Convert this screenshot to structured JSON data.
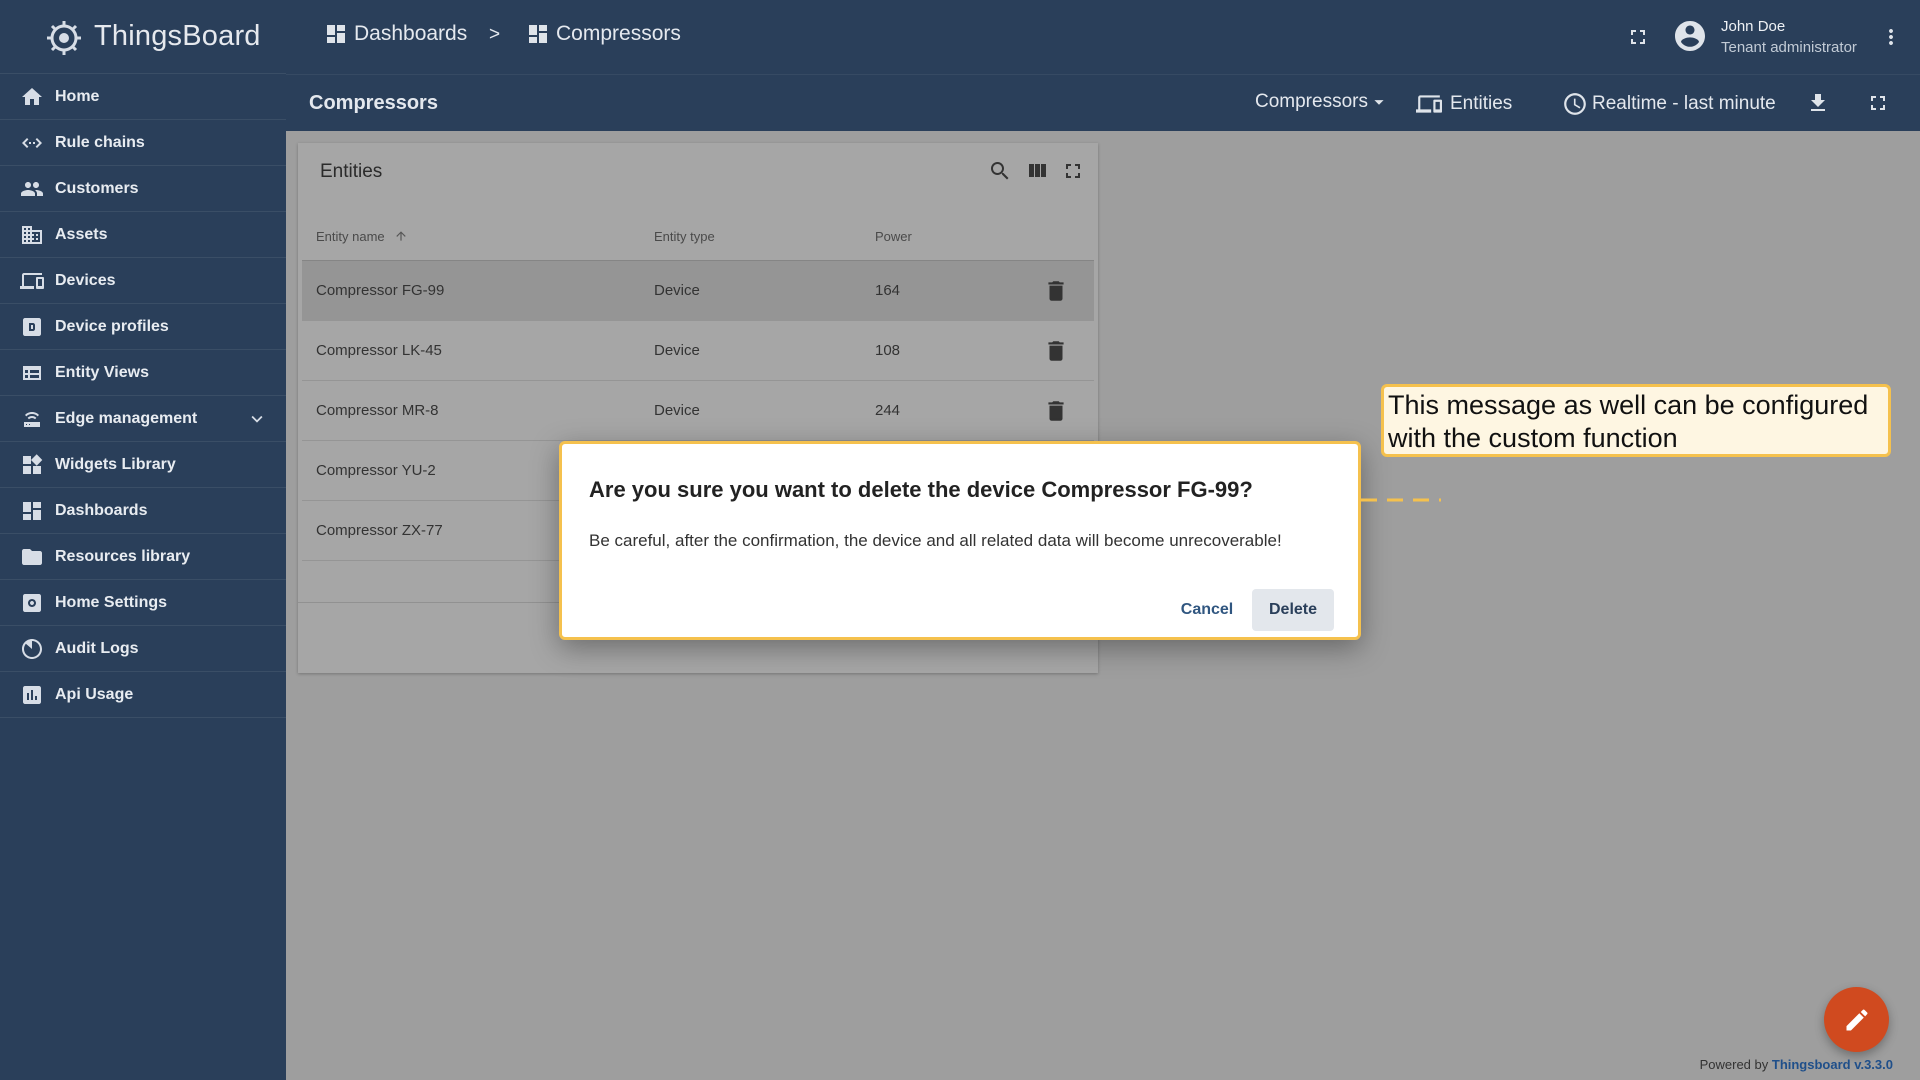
{
  "app": {
    "name": "ThingsBoard"
  },
  "sidebar": {
    "items": [
      {
        "label": "Home",
        "icon": "home-icon"
      },
      {
        "label": "Rule chains",
        "icon": "rule-chains-icon"
      },
      {
        "label": "Customers",
        "icon": "customers-icon"
      },
      {
        "label": "Assets",
        "icon": "assets-icon"
      },
      {
        "label": "Devices",
        "icon": "devices-icon"
      },
      {
        "label": "Device profiles",
        "icon": "device-profiles-icon"
      },
      {
        "label": "Entity Views",
        "icon": "entity-views-icon"
      },
      {
        "label": "Edge management",
        "icon": "edge-icon"
      },
      {
        "label": "Widgets Library",
        "icon": "widgets-icon"
      },
      {
        "label": "Dashboards",
        "icon": "dashboards-icon"
      },
      {
        "label": "Resources library",
        "icon": "folder-icon"
      },
      {
        "label": "Home Settings",
        "icon": "settings-icon"
      },
      {
        "label": "Audit Logs",
        "icon": "audit-icon"
      },
      {
        "label": "Api Usage",
        "icon": "api-usage-icon"
      }
    ]
  },
  "header": {
    "breadcrumb": [
      "Dashboards",
      "Compressors"
    ],
    "separator": ">",
    "user": {
      "name": "John Doe",
      "role": "Tenant administrator"
    }
  },
  "dashboard": {
    "title": "Compressors",
    "state_select": "Compressors",
    "entities_label": "Entities",
    "timewindow": "Realtime - last minute"
  },
  "widget": {
    "title": "Entities",
    "columns": [
      "Entity name",
      "Entity type",
      "Power"
    ],
    "rows": [
      {
        "name": "Compressor FG-99",
        "type": "Device",
        "power": "164"
      },
      {
        "name": "Compressor LK-45",
        "type": "Device",
        "power": "108"
      },
      {
        "name": "Compressor MR-8",
        "type": "Device",
        "power": "244"
      },
      {
        "name": "Compressor YU-2",
        "type": "",
        "power": ""
      },
      {
        "name": "Compressor ZX-77",
        "type": "",
        "power": ""
      }
    ]
  },
  "dialog": {
    "title": "Are you sure you want to delete the device Compressor FG-99?",
    "message": "Be careful, after the confirmation, the device and all related data will become unrecoverable!",
    "cancel_label": "Cancel",
    "delete_label": "Delete"
  },
  "callout": {
    "text": "This message as well can be configured with the custom function"
  },
  "footer": {
    "powered_by": "Powered by",
    "link_text": "Thingsboard v.3.3.0"
  },
  "colors": {
    "primary": "#2a3f5a",
    "accent": "#f5c14d",
    "fab": "#d04a1f"
  }
}
